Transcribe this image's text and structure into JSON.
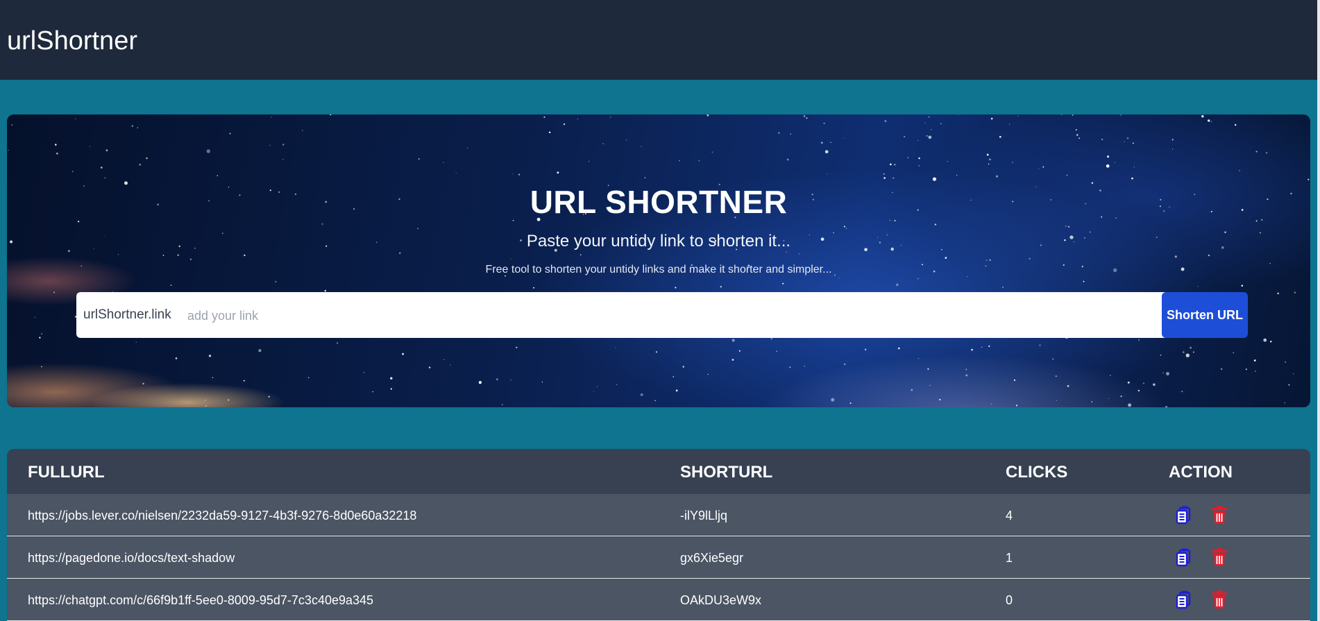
{
  "app": {
    "brand": "urlShortner"
  },
  "hero": {
    "title": "URL SHORTNER",
    "subtitle": "Paste your untidy link to shorten it...",
    "description": "Free tool to shorten your untidy links and make it shorter and simpler...",
    "input_prefix": "urlShortner.link",
    "input_placeholder": "add your link",
    "input_value": "",
    "button_label": "Shorten URL"
  },
  "table": {
    "headers": {
      "fullurl": "FULLURL",
      "shorturl": "SHORTURL",
      "clicks": "CLICKS",
      "action": "ACTION"
    },
    "rows": [
      {
        "fullurl": "https://jobs.lever.co/nielsen/2232da59-9127-4b3f-9276-8d0e60a32218",
        "shorturl": "-ilY9lLljq",
        "clicks": "4"
      },
      {
        "fullurl": "https://pagedone.io/docs/text-shadow",
        "shorturl": "gx6Xie5egr",
        "clicks": "1"
      },
      {
        "fullurl": "https://chatgpt.com/c/66f9b1ff-5ee0-8009-95d7-7c3c40e9a345",
        "shorturl": "OAkDU3eW9x",
        "clicks": "0"
      }
    ],
    "icons": {
      "copy": "clipboard-copy-icon",
      "delete": "trash-icon"
    }
  },
  "colors": {
    "page_bg": "#0e7490",
    "navbar_bg": "#1e293b",
    "button_bg": "#1d4ed8",
    "table_header_bg": "#374151",
    "table_row_bg": "#4b5563",
    "copy_icon": "#1d1dd8",
    "delete_icon": "#e11d2e"
  }
}
